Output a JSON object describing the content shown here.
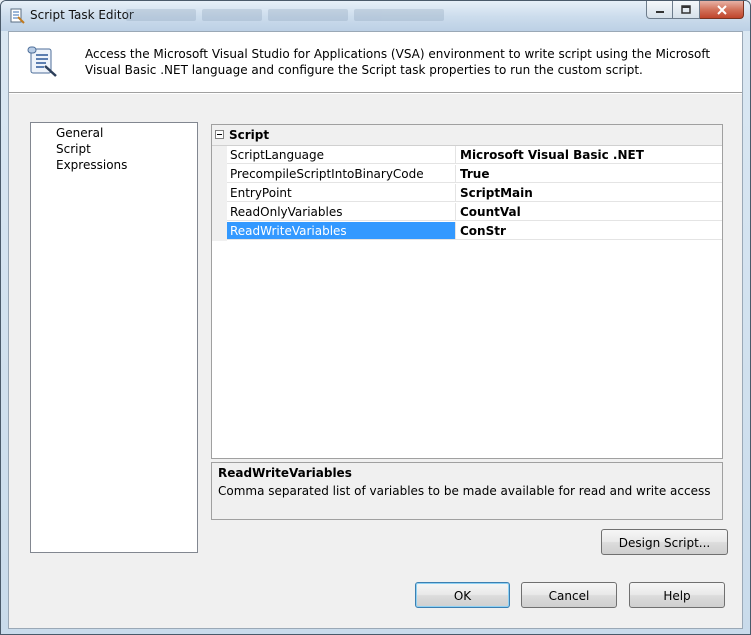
{
  "window": {
    "title": "Script Task Editor"
  },
  "header": {
    "description": "Access the Microsoft Visual Studio for Applications (VSA) environment to write script using the Microsoft Visual Basic .NET language and configure the Script task properties to run the custom script."
  },
  "nav": {
    "items": [
      {
        "label": "General"
      },
      {
        "label": "Script"
      },
      {
        "label": "Expressions"
      }
    ]
  },
  "property_grid": {
    "category": "Script",
    "rows": [
      {
        "name": "ScriptLanguage",
        "value": "Microsoft Visual Basic .NET"
      },
      {
        "name": "PrecompileScriptIntoBinaryCode",
        "value": "True"
      },
      {
        "name": "EntryPoint",
        "value": "ScriptMain"
      },
      {
        "name": "ReadOnlyVariables",
        "value": "CountVal"
      },
      {
        "name": "ReadWriteVariables",
        "value": "ConStr"
      }
    ],
    "selected_row": "ReadWriteVariables"
  },
  "description_panel": {
    "title": "ReadWriteVariables",
    "text": "Comma separated list of variables to be made available for read and write access"
  },
  "buttons": {
    "design_script": "Design Script...",
    "ok": "OK",
    "cancel": "Cancel",
    "help": "Help"
  },
  "colors": {
    "selection": "#3399ff",
    "dialog_bg": "#f0f0f0"
  }
}
